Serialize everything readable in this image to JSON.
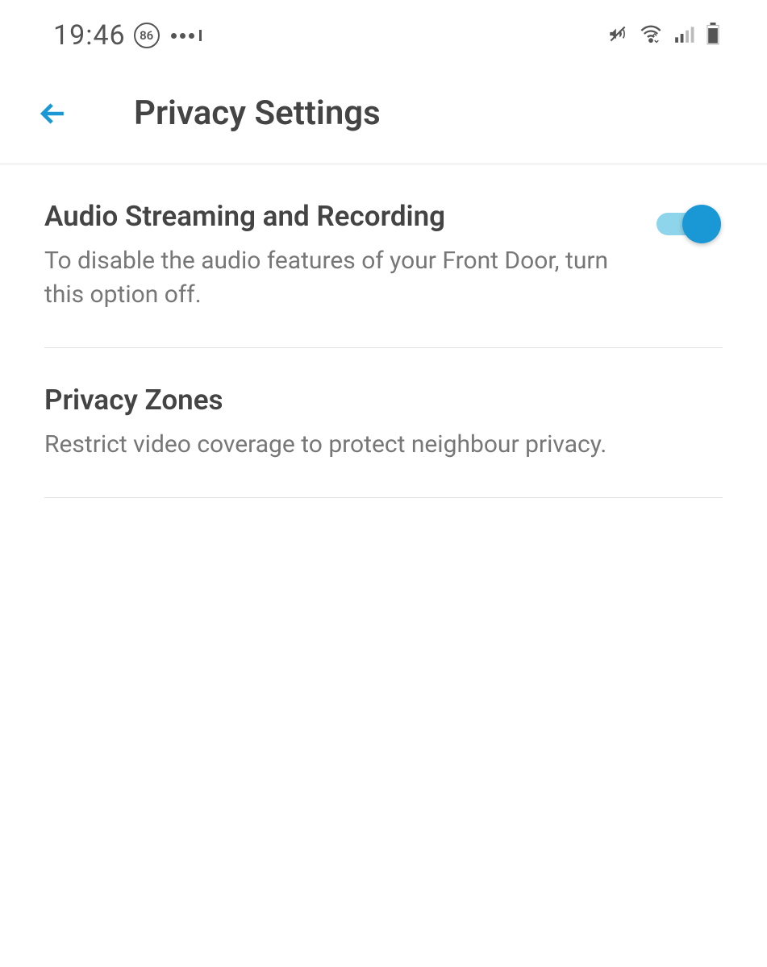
{
  "statusBar": {
    "time": "19:46",
    "badge": "86"
  },
  "header": {
    "title": "Privacy Settings"
  },
  "settings": {
    "items": [
      {
        "title": "Audio Streaming and Recording",
        "description": "To disable the audio features of your Front Door, turn this option off.",
        "hasToggle": true,
        "toggleOn": true
      },
      {
        "title": "Privacy Zones",
        "description": "Restrict video coverage to protect neighbour privacy.",
        "hasToggle": false
      }
    ]
  }
}
